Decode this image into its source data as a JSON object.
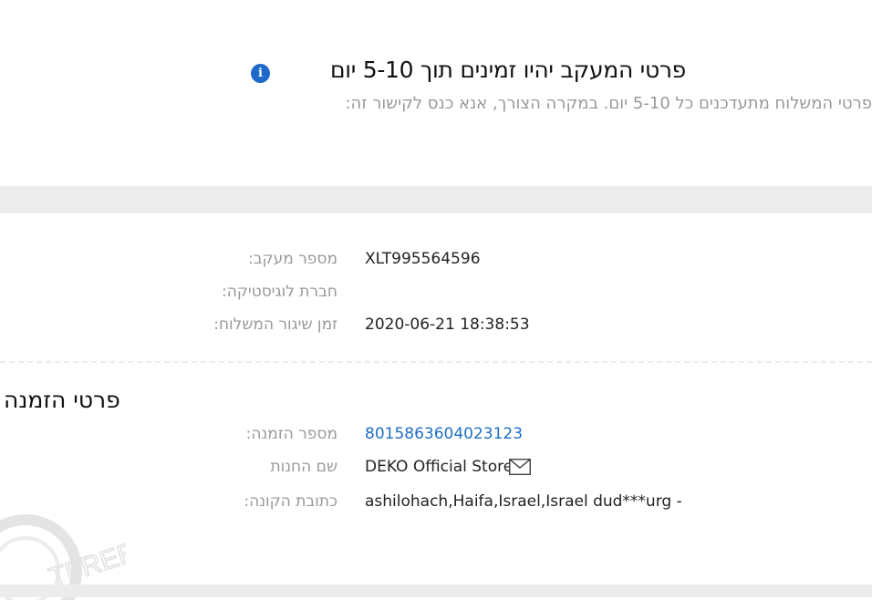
{
  "notice": {
    "title": "פרטי המעקב יהיו זמינים תוך 5-10 יום",
    "subtitle": "פרטי המשלוח מתעדכנים כל 5-10 יום. במקרה הצורך, אנא כנס לקישור זה:"
  },
  "tracking": {
    "tracking_number_label": "מספר מעקב:",
    "tracking_number": "XLT995564596",
    "logistics_label": "חברת לוגיסטיקה:",
    "logistics_value": "",
    "ship_time_label": "זמן שיגור המשלוח:",
    "ship_time": "2020-06-21 18:38:53"
  },
  "order": {
    "section_title": "פרטי הזמנה",
    "order_number_label": "מספר הזמנה:",
    "order_number": "8015863604023123",
    "store_label": "שם החנות",
    "store_name": "DEKO Official Store",
    "address_label": "כתובת הקונה:",
    "address": "ashilohach,Haifa,Israel,Israel dud***urg -"
  },
  "icons": {
    "info": "info-icon",
    "mail": "mail-icon"
  },
  "watermark_text": "TFREE",
  "colors": {
    "accent": "#1f69c9",
    "link": "#1f6fc5",
    "label": "#999999",
    "band": "#ececec"
  }
}
